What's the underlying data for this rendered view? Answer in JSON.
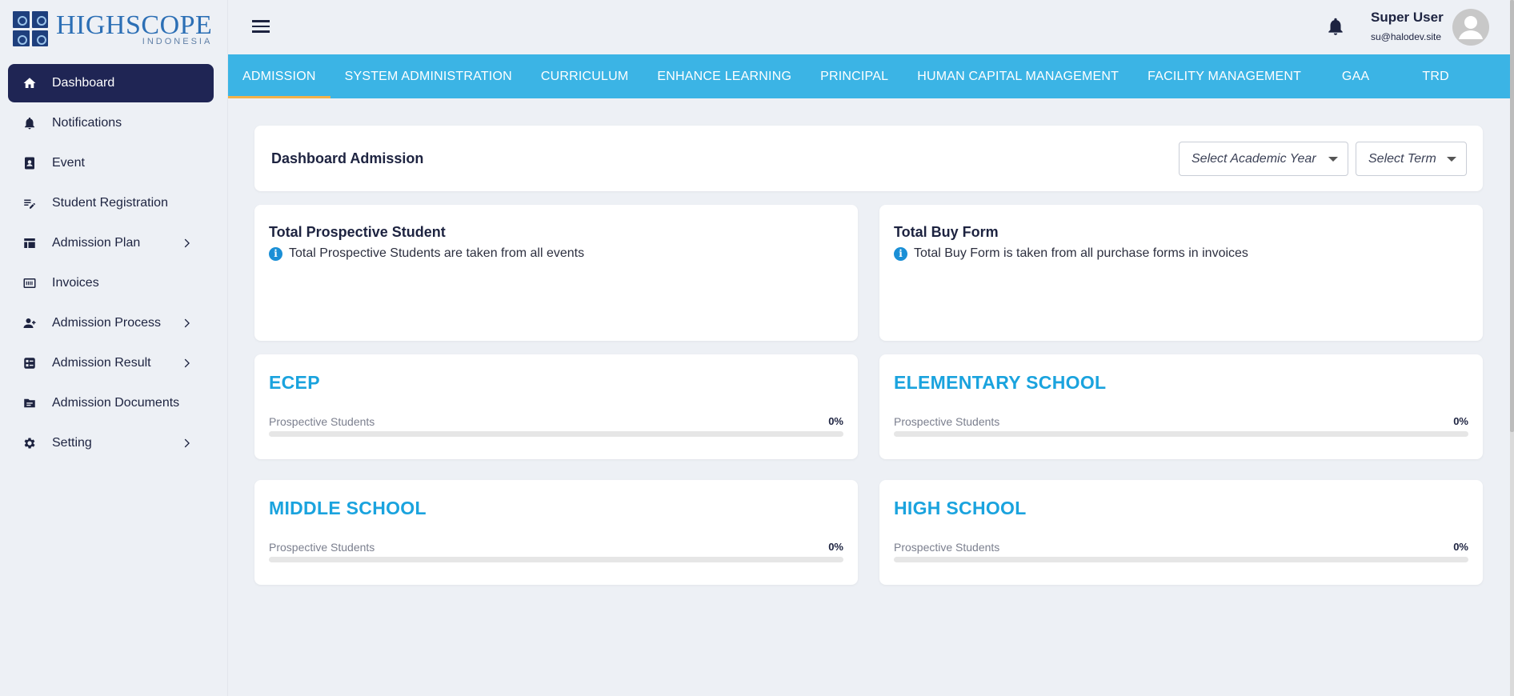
{
  "brand": {
    "title": "HIGHSCOPE",
    "subtitle": "INDONESIA"
  },
  "sidebar": {
    "items": [
      {
        "label": "Dashboard",
        "icon": "home-icon",
        "active": true,
        "has_children": false
      },
      {
        "label": "Notifications",
        "icon": "bell-icon",
        "active": false,
        "has_children": false
      },
      {
        "label": "Event",
        "icon": "contact-card-icon",
        "active": false,
        "has_children": false
      },
      {
        "label": "Student Registration",
        "icon": "edit-note-icon",
        "active": false,
        "has_children": false
      },
      {
        "label": "Admission Plan",
        "icon": "table-icon",
        "active": false,
        "has_children": true
      },
      {
        "label": "Invoices",
        "icon": "receipt-icon",
        "active": false,
        "has_children": false
      },
      {
        "label": "Admission Process",
        "icon": "person-add-icon",
        "active": false,
        "has_children": true
      },
      {
        "label": "Admission Result",
        "icon": "checklist-icon",
        "active": false,
        "has_children": true
      },
      {
        "label": "Admission Documents",
        "icon": "folder-icon",
        "active": false,
        "has_children": false
      },
      {
        "label": "Setting",
        "icon": "gear-icon",
        "active": false,
        "has_children": true
      }
    ]
  },
  "header": {
    "user_name": "Super User",
    "user_email": "su@halodev.site"
  },
  "tabs": [
    {
      "label": "ADMISSION",
      "active": true
    },
    {
      "label": "SYSTEM ADMINISTRATION",
      "active": false
    },
    {
      "label": "CURRICULUM",
      "active": false
    },
    {
      "label": "ENHANCE LEARNING",
      "active": false
    },
    {
      "label": "PRINCIPAL",
      "active": false
    },
    {
      "label": "HUMAN CAPITAL MANAGEMENT",
      "active": false
    },
    {
      "label": "FACILITY MANAGEMENT",
      "active": false
    },
    {
      "label": "GAA",
      "active": false
    },
    {
      "label": "TRD",
      "active": false
    }
  ],
  "main": {
    "title": "Dashboard Admission",
    "academic_year_select": "Select Academic Year",
    "term_select": "Select Term",
    "stats": [
      {
        "title": "Total Prospective Student",
        "note": "Total Prospective Students are taken from all events"
      },
      {
        "title": "Total Buy Form",
        "note": "Total Buy Form is taken from all purchase forms in invoices"
      }
    ],
    "schools": [
      {
        "name": "ECEP",
        "label": "Prospective Students",
        "percent": "0%",
        "progress": 0
      },
      {
        "name": "ELEMENTARY SCHOOL",
        "label": "Prospective Students",
        "percent": "0%",
        "progress": 0
      },
      {
        "name": "MIDDLE SCHOOL",
        "label": "Prospective Students",
        "percent": "0%",
        "progress": 0
      },
      {
        "name": "HIGH SCHOOL",
        "label": "Prospective Students",
        "percent": "0%",
        "progress": 0
      }
    ]
  },
  "colors": {
    "accent": "#3bb4e5",
    "sidebar_active": "#1f2554",
    "school_title": "#1aa3de",
    "tab_indicator": "#f2b24a"
  }
}
